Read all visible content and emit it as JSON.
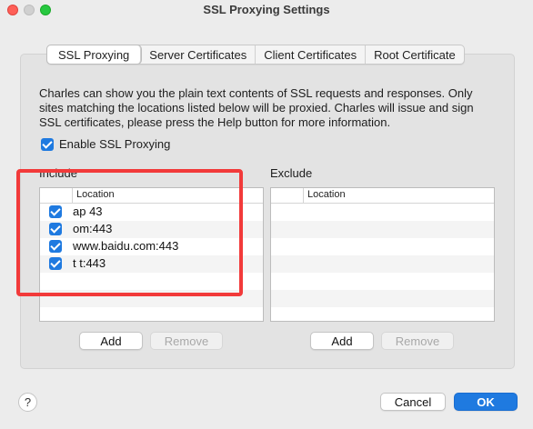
{
  "window": {
    "title": "SSL Proxying Settings"
  },
  "tabs": [
    {
      "label": "SSL Proxying",
      "active": true
    },
    {
      "label": "Server Certificates",
      "active": false
    },
    {
      "label": "Client Certificates",
      "active": false
    },
    {
      "label": "Root Certificate",
      "active": false
    }
  ],
  "description": "Charles can show you the plain text contents of SSL requests and responses. Only sites matching the locations listed below will be proxied. Charles will issue and sign SSL certificates, please press the Help button for more information.",
  "enable_ssl": {
    "label": "Enable SSL Proxying",
    "checked": true
  },
  "include": {
    "label": "Include",
    "column": "Location",
    "rows": [
      {
        "checked": true,
        "location": "ap          43"
      },
      {
        "checked": true,
        "location": "             om:443"
      },
      {
        "checked": true,
        "location": "www.baidu.com:443"
      },
      {
        "checked": true,
        "location": "t                    t:443"
      }
    ],
    "add_label": "Add",
    "remove_label": "Remove"
  },
  "exclude": {
    "label": "Exclude",
    "column": "Location",
    "rows": [],
    "add_label": "Add",
    "remove_label": "Remove"
  },
  "footer": {
    "help_label": "?",
    "cancel_label": "Cancel",
    "ok_label": "OK"
  },
  "colors": {
    "accent": "#1f7ae0",
    "annotation": "#f23a3a"
  }
}
